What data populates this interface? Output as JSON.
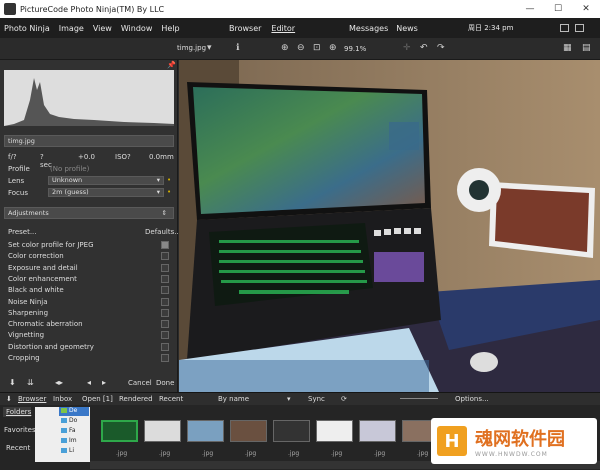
{
  "window": {
    "title": "PictureCode Photo Ninja(TM) By LLC",
    "min": "—",
    "max": "☐",
    "close": "✕"
  },
  "menu": {
    "items": [
      "Photo Ninja",
      "Image",
      "View",
      "Window",
      "Help"
    ],
    "views": [
      "Browser",
      "Editor"
    ],
    "extras": [
      "Messages",
      "News"
    ],
    "clock": "周日 2:34 pm"
  },
  "toolbar": {
    "filename": "timg.jpg",
    "zoom": "99.1%"
  },
  "left": {
    "file_label": "timg.jpg",
    "exif": {
      "fstop": "f/?",
      "shutter": "? sec",
      "ev": "+0.0",
      "iso": "ISO?",
      "focal": "0.0mm"
    },
    "profile_label": "Profile",
    "profile_value": "(No profile)",
    "lens_label": "Lens",
    "lens_value": "Unknown",
    "focus_label": "Focus",
    "focus_value": "2m (guess)",
    "adjustments": "Adjustments",
    "preset": "Preset...",
    "defaults": "Defaults...",
    "adjust_items": [
      "Set color profile for JPEG",
      "Color correction",
      "Exposure and detail",
      "Color enhancement",
      "Black and white",
      "Noise Ninja",
      "Sharpening",
      "Chromatic aberration",
      "Vignetting",
      "Distortion and geometry",
      "Cropping"
    ],
    "cancel": "Cancel",
    "done": "Done"
  },
  "browser": {
    "tabs": [
      "Browser",
      "Inbox",
      "Open [1]",
      "Rendered",
      "Recent"
    ],
    "sort": "By name",
    "sync": "Sync",
    "options": "Options...",
    "side": [
      "Folders",
      "Favorites",
      "Recent"
    ],
    "tree": [
      "De",
      "Do",
      "Fa",
      "Im",
      "Li"
    ],
    "thumb_labels": [
      ".jpg",
      ".jpg",
      ".jpg",
      ".jpg",
      ".jpg",
      ".jpg",
      ".jpg",
      ".jpg",
      ".jpg"
    ]
  },
  "watermark": {
    "brand": "魂网软件园",
    "url": "WWW.HNWDW.COM"
  }
}
